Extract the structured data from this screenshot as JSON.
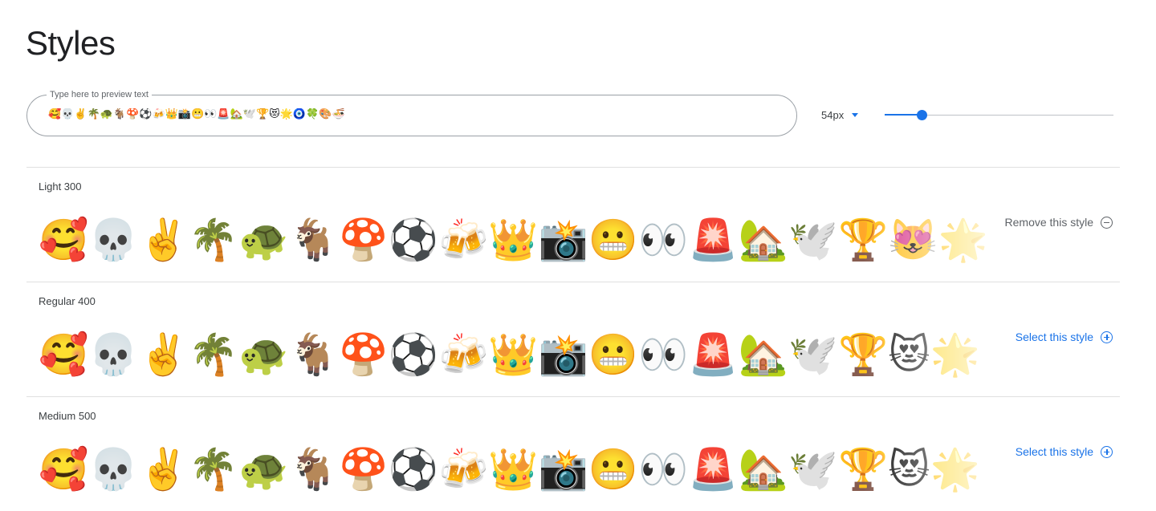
{
  "page": {
    "title": "Styles"
  },
  "preview": {
    "label": "Type here to preview text",
    "value": "🥰💀✌️🌴🐢🐐🍄⚽🍻👑📸😬👀🚨🏡🕊️🏆😻🌟🧿🍀🎨🍜"
  },
  "size": {
    "selected": "54px",
    "slider_value_fraction": 0.16
  },
  "glyphs": "🥰💀✌️🌴🐢🐐🍄⚽🍻👑📸😬👀🚨🏡🕊️🏆😻🌟",
  "styles": [
    {
      "name": "Light 300",
      "action": "Remove this style",
      "action_icon": "minus-circle-icon"
    },
    {
      "name": "Regular 400",
      "action": "Select this style",
      "action_icon": "plus-circle-icon"
    },
    {
      "name": "Medium 500",
      "action": "Select this style",
      "action_icon": "plus-circle-icon"
    }
  ],
  "colors": {
    "accent": "#1a73e8",
    "text": "#202124",
    "muted": "#5f6368",
    "divider": "#e0e0e0"
  }
}
